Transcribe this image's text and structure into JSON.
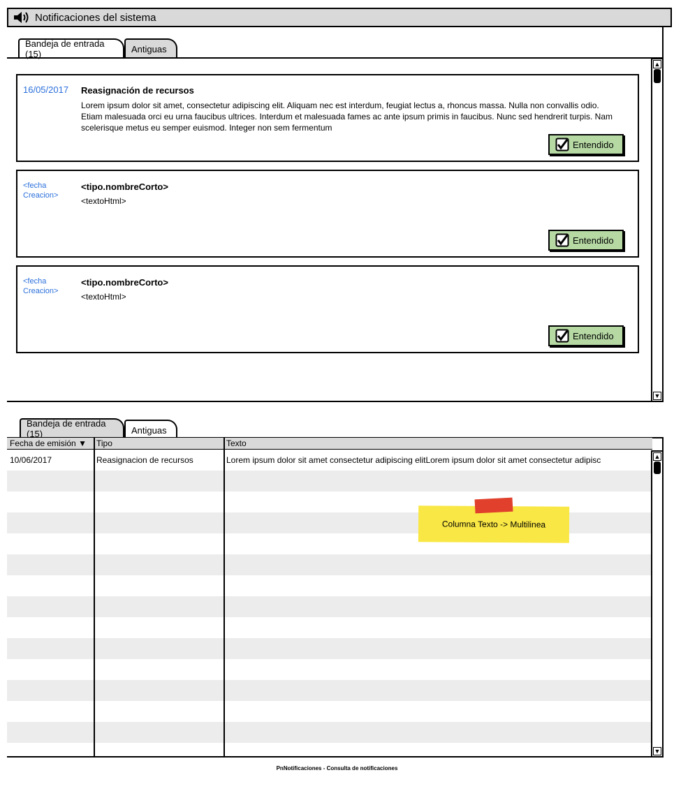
{
  "window": {
    "title": "Notificaciones del sistema",
    "icon": "speaker-icon"
  },
  "top_tabs": [
    {
      "label": "Bandeja de entrada (15)",
      "active": true
    },
    {
      "label": "Antiguas",
      "active": false
    }
  ],
  "notifications": [
    {
      "date": "16/05/2017",
      "title": "Reasignación de recursos",
      "body": "Lorem ipsum dolor sit amet, consectetur adipiscing elit. Aliquam nec est interdum, feugiat lectus a, rhoncus massa. Nulla non convallis odio. Etiam malesuada orci eu urna faucibus ultrices. Interdum et malesuada fames ac ante ipsum primis in faucibus. Nunc sed hendrerit turpis. Nam scelerisque metus eu semper euismod. Integer non sem fermentum",
      "button": "Entendido"
    },
    {
      "date": "<fecha Creacion>",
      "title": "<tipo.nombreCorto>",
      "body": "<textoHtml>",
      "button": "Entendido"
    },
    {
      "date": "<fecha Creacion>",
      "title": "<tipo.nombreCorto>",
      "body": "<textoHtml>",
      "button": "Entendido"
    }
  ],
  "bottom_tabs": [
    {
      "label": "Bandeja de entrada (15)",
      "active": false
    },
    {
      "label": "Antiguas",
      "active": true
    }
  ],
  "table": {
    "columns": [
      "Fecha de emisión",
      "Tipo",
      "Texto"
    ],
    "sort_indicator": "▼",
    "rows": [
      [
        "10/06/2017",
        "Reasignacion de recursos",
        "Lorem ipsum dolor sit amet consectetur adipiscing elitLorem ipsum dolor sit amet consectetur adipisc"
      ]
    ]
  },
  "sticky_note": "Columna Texto -> Multilinea",
  "footer": "PnNotificaciones - Consulta de notificaciones",
  "colors": {
    "date_blue": "#2a6fdb",
    "button_green": "#b6d9a4",
    "sticky_yellow": "#f9e745",
    "tape_red": "#e0402c"
  }
}
